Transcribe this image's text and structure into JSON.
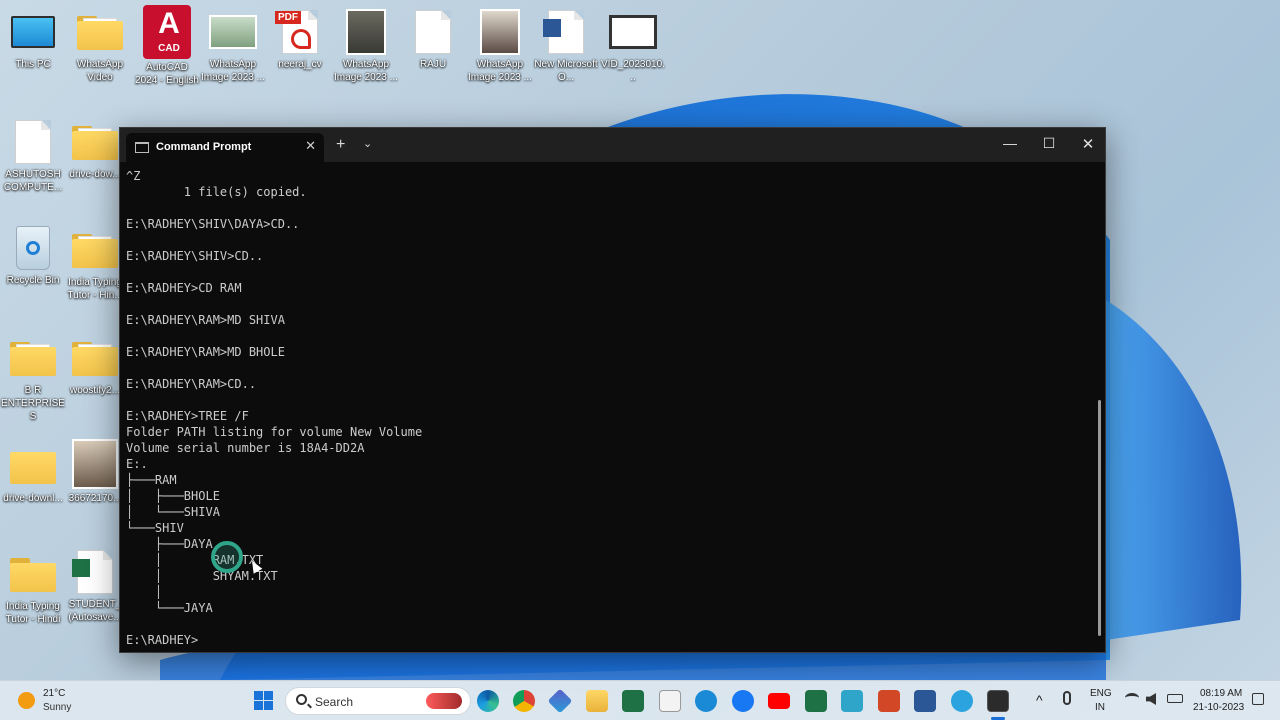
{
  "desktop": {
    "icons": [
      {
        "label": "This PC"
      },
      {
        "label": "WhatsApp Video"
      },
      {
        "label": "AutoCAD 2024 - English"
      },
      {
        "label": "WhatsApp Image 2023 ..."
      },
      {
        "label": "neeraj_cv"
      },
      {
        "label": "WhatsApp Image 2023 ..."
      },
      {
        "label": "RAJU"
      },
      {
        "label": "WhatsApp Image 2023 ..."
      },
      {
        "label": "New Microsoft O..."
      },
      {
        "label": "VID_2023010..."
      },
      {
        "label": "ASHUTOSH COMPUTE..."
      },
      {
        "label": "drive-dow..."
      },
      {
        "label": "Recycle Bin"
      },
      {
        "label": "India Typing Tutor - Hin..."
      },
      {
        "label": "B R ENTERPRISES"
      },
      {
        "label": "woostify2..."
      },
      {
        "label": "drive-downl..."
      },
      {
        "label": "36672170..."
      },
      {
        "label": "India Typing Tutor - Hindi"
      },
      {
        "label": "STUDENT_ (Autosave..."
      }
    ],
    "badges": {
      "cad": "CAD",
      "pdf": "PDF",
      "autocad_letter": "A"
    }
  },
  "terminal": {
    "tab_title": "Command Prompt",
    "new_tab": "+",
    "dropdown": "⌄",
    "close_tab": "✕",
    "minimize": "—",
    "maximize": "☐",
    "close": "✕",
    "output": "^Z\n        1 file(s) copied.\n\nE:\\RADHEY\\SHIV\\DAYA>CD..\n\nE:\\RADHEY\\SHIV>CD..\n\nE:\\RADHEY>CD RAM\n\nE:\\RADHEY\\RAM>MD SHIVA\n\nE:\\RADHEY\\RAM>MD BHOLE\n\nE:\\RADHEY\\RAM>CD..\n\nE:\\RADHEY>TREE /F\nFolder PATH listing for volume New Volume\nVolume serial number is 18A4-DD2A\nE:.\n├───RAM\n│   ├───BHOLE\n│   └───SHIVA\n└───SHIV\n    ├───DAYA\n    │       RAM.TXT\n    │       SHYAM.TXT\n    │\n    └───JAYA\n\nE:\\RADHEY>"
  },
  "taskbar": {
    "weather": {
      "temp": "21°C",
      "condition": "Sunny"
    },
    "search_placeholder": "Search",
    "tray": {
      "lang1": "ENG",
      "lang2": "IN"
    },
    "clock": {
      "time": "08:19 AM",
      "date": "21-10-2023"
    }
  },
  "colors": {
    "console_bg": "#0c0c0c",
    "console_fg": "#cccccc",
    "cursor_ring": "#2fa58a",
    "accent": "#1a6fd6"
  }
}
